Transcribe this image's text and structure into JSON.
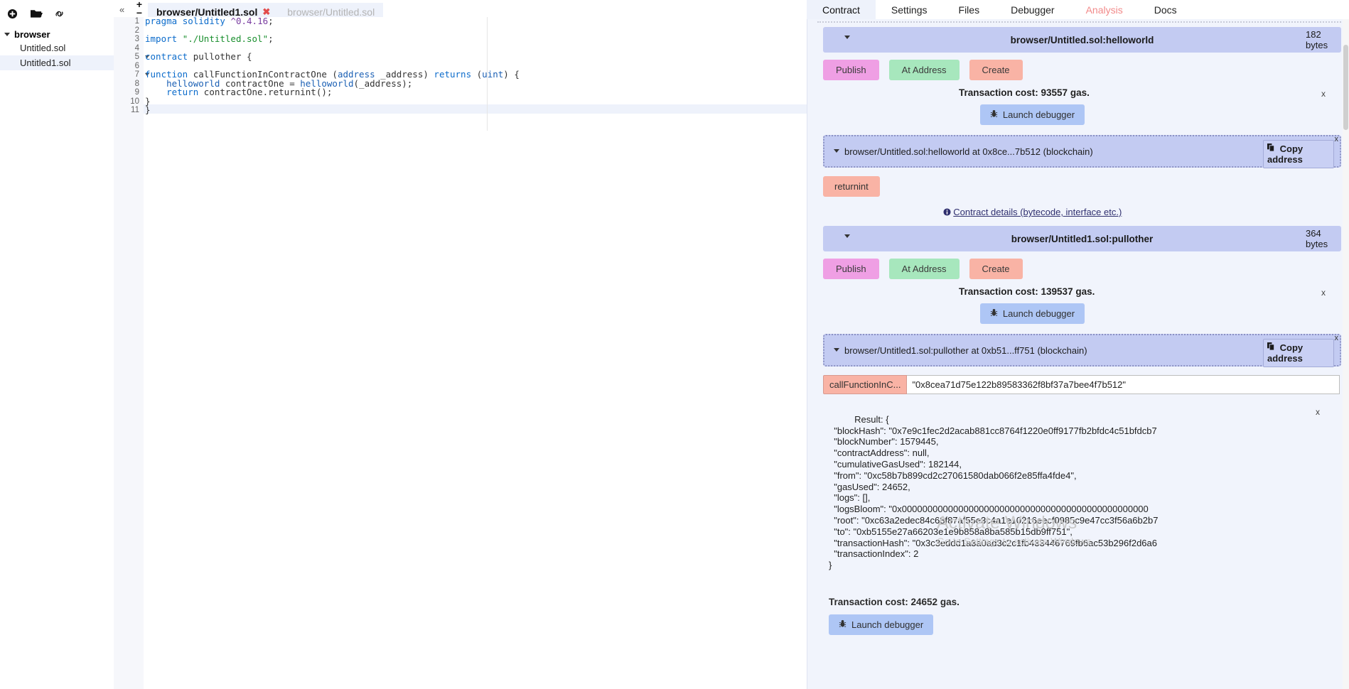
{
  "filepanel": {
    "icons": [
      {
        "name": "create-file-icon",
        "glyph": "circle-plus"
      },
      {
        "name": "open-folder-icon",
        "glyph": "folder"
      },
      {
        "name": "copy-link-icon",
        "glyph": "link"
      }
    ],
    "root_label": "browser",
    "files": [
      {
        "label": "Untitled.sol",
        "selected": false
      },
      {
        "label": "Untitled1.sol",
        "selected": true
      }
    ]
  },
  "editor": {
    "collapse_glyph": "«",
    "zoom_in": "+",
    "zoom_out": "−",
    "tabs": [
      {
        "label": "browser/Untitled1.sol",
        "active": true,
        "close": "✖"
      },
      {
        "label": "browser/Untitled.sol",
        "active": false,
        "close": ""
      }
    ],
    "line_numbers": [
      "1",
      "2",
      "3",
      "4",
      "5",
      "6",
      "7",
      "8",
      "9",
      "10",
      "11"
    ],
    "fold_lines": [
      5,
      7
    ],
    "code": [
      "pragma solidity ^0.4.16;",
      "",
      "import \"./Untitled.sol\";",
      "",
      "contract pullother {",
      "",
      "function callFunctionInContractOne (address _address) returns (uint) {",
      "    helloworld contractOne = helloworld(_address);",
      "    return contractOne.returnint();",
      "}",
      "}"
    ]
  },
  "rightpanel": {
    "expand_glyph": "»",
    "tabs": [
      {
        "label": "Contract",
        "active": true,
        "style": "normal"
      },
      {
        "label": "Settings",
        "active": false,
        "style": "normal"
      },
      {
        "label": "Files",
        "active": false,
        "style": "normal"
      },
      {
        "label": "Debugger",
        "active": false,
        "style": "normal"
      },
      {
        "label": "Analysis",
        "active": false,
        "style": "analysis"
      },
      {
        "label": "Docs",
        "active": false,
        "style": "normal"
      }
    ],
    "contracts": [
      {
        "title": "browser/Untitled.sol:helloworld",
        "size": "182 bytes",
        "publish_label": "Publish",
        "ataddress_label": "At Address",
        "create_label": "Create",
        "transaction_cost": "Transaction cost: 93557 gas.",
        "close_label": "x",
        "debug_label": "Launch debugger",
        "instance_title": "browser/Untitled.sol:helloworld at 0x8ce...7b512 (blockchain)",
        "copy_label": "Copy address",
        "instance_close": "x",
        "function_button": "returnint",
        "details_link": "Contract details (bytecode, interface etc.)"
      },
      {
        "title": "browser/Untitled1.sol:pullother",
        "size": "364 bytes",
        "publish_label": "Publish",
        "ataddress_label": "At Address",
        "create_label": "Create",
        "transaction_cost": "Transaction cost: 139537 gas.",
        "close_label": "x",
        "debug_label": "Launch debugger",
        "instance_title": "browser/Untitled1.sol:pullother at 0xb51...ff751 (blockchain)",
        "copy_label": "Copy address",
        "instance_close": "x",
        "function_button": "callFunctionInC...",
        "function_input_value": "\"0x8cea71d75e122b89583362f8bf37a7bee4f7b512\"",
        "result_text": "Result: {\n  \"blockHash\": \"0x7e9c1fec2d2acab881cc8764f1220e0ff9177fb2bfdc4c51bfdcb7\n  \"blockNumber\": 1579445,\n  \"contractAddress\": null,\n  \"cumulativeGasUsed\": 182144,\n  \"from\": \"0xc58b7b899cd2c27061580dab066f2e85ffa4fde4\",\n  \"gasUsed\": 24652,\n  \"logs\": [],\n  \"logsBloom\": \"0x000000000000000000000000000000000000000000000000\n  \"root\": \"0xc63a2edec84c68f87af55e3c4a1e10216eecf0985c9e47cc3f56a6b2b7\n  \"to\": \"0xb5155e27a66203e1e9b858a8ba585b15db9ff751\",\n  \"transactionHash\": \"0x3c3eddd1a3a0ad3c2c1fb433446769fb6ac53b296f2d6a6\n  \"transactionIndex\": 2\n}",
        "result_close": "x",
        "result_cost": "Transaction cost: 24652 gas.",
        "bottom_debug_label": "Launch debugger"
      }
    ]
  },
  "watermark": {
    "title": "Activate Windows",
    "subtitle": "Go to Settings to activate Windows."
  }
}
